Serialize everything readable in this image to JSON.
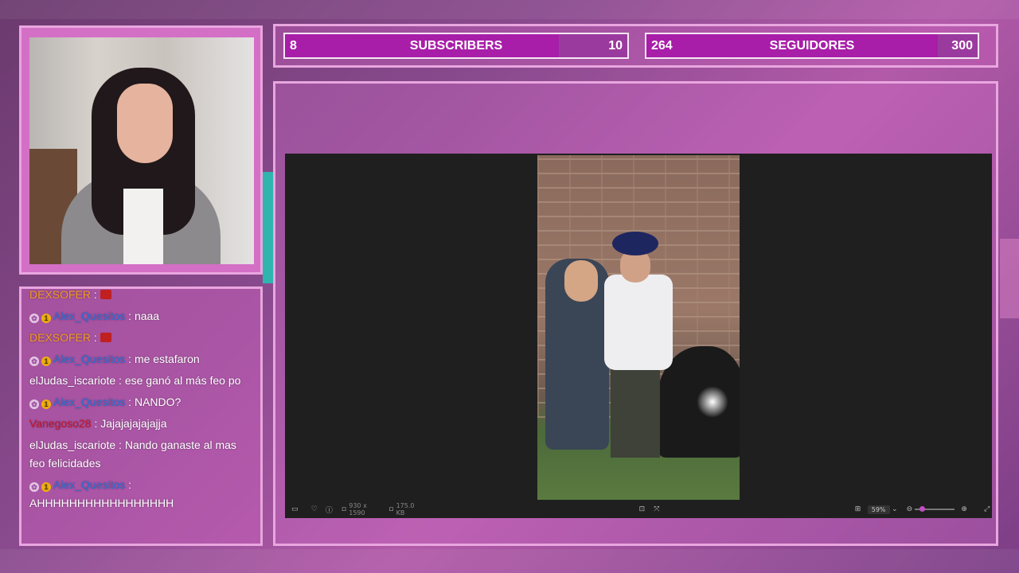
{
  "goals": [
    {
      "current": "8",
      "label": "SUBSCRIBERS",
      "target": "10",
      "progress": 0.8
    },
    {
      "current": "264",
      "label": "SEGUIDORES",
      "target": "300",
      "progress": 0.88
    }
  ],
  "viewer": {
    "image_info": "930 x 1590",
    "file_size": "175.0 KB",
    "zoom": "59%"
  },
  "chat": [
    {
      "user": "DEXSOFER",
      "text": "",
      "user_color": "u-orange",
      "badges": [],
      "emote": true
    },
    {
      "user": "Alex_Quesitos",
      "text": "naaa",
      "user_color": "u-blue",
      "badges": [
        "flower",
        "one"
      ]
    },
    {
      "user": "DEXSOFER",
      "text": "",
      "user_color": "u-orange",
      "badges": [],
      "emote": true
    },
    {
      "user": "Alex_Quesitos",
      "text": "me estafaron",
      "user_color": "u-blue",
      "badges": [
        "flower",
        "one"
      ]
    },
    {
      "user": "elJudas_iscariote",
      "text": "ese ganó al más feo po",
      "user_color": "u-white",
      "badges": []
    },
    {
      "user": "Alex_Quesitos",
      "text": "NANDO?",
      "user_color": "u-blue",
      "badges": [
        "flower",
        "one"
      ]
    },
    {
      "user": "Vanegoso28",
      "text": "Jajajajajajajja",
      "user_color": "u-red",
      "badges": []
    },
    {
      "user": "elJudas_iscariote",
      "text": "Nando ganaste al mas feo felicidades",
      "user_color": "u-white",
      "badges": []
    },
    {
      "user": "Alex_Quesitos",
      "text": "AHHHHHHHHHHHHHHHHH",
      "user_color": "u-blue",
      "badges": [
        "flower",
        "one"
      ]
    }
  ],
  "colors": {
    "frame_border": "#e9a6df",
    "goal_fill": "#a81ea8",
    "viewer_bg": "#1f1f1f"
  }
}
